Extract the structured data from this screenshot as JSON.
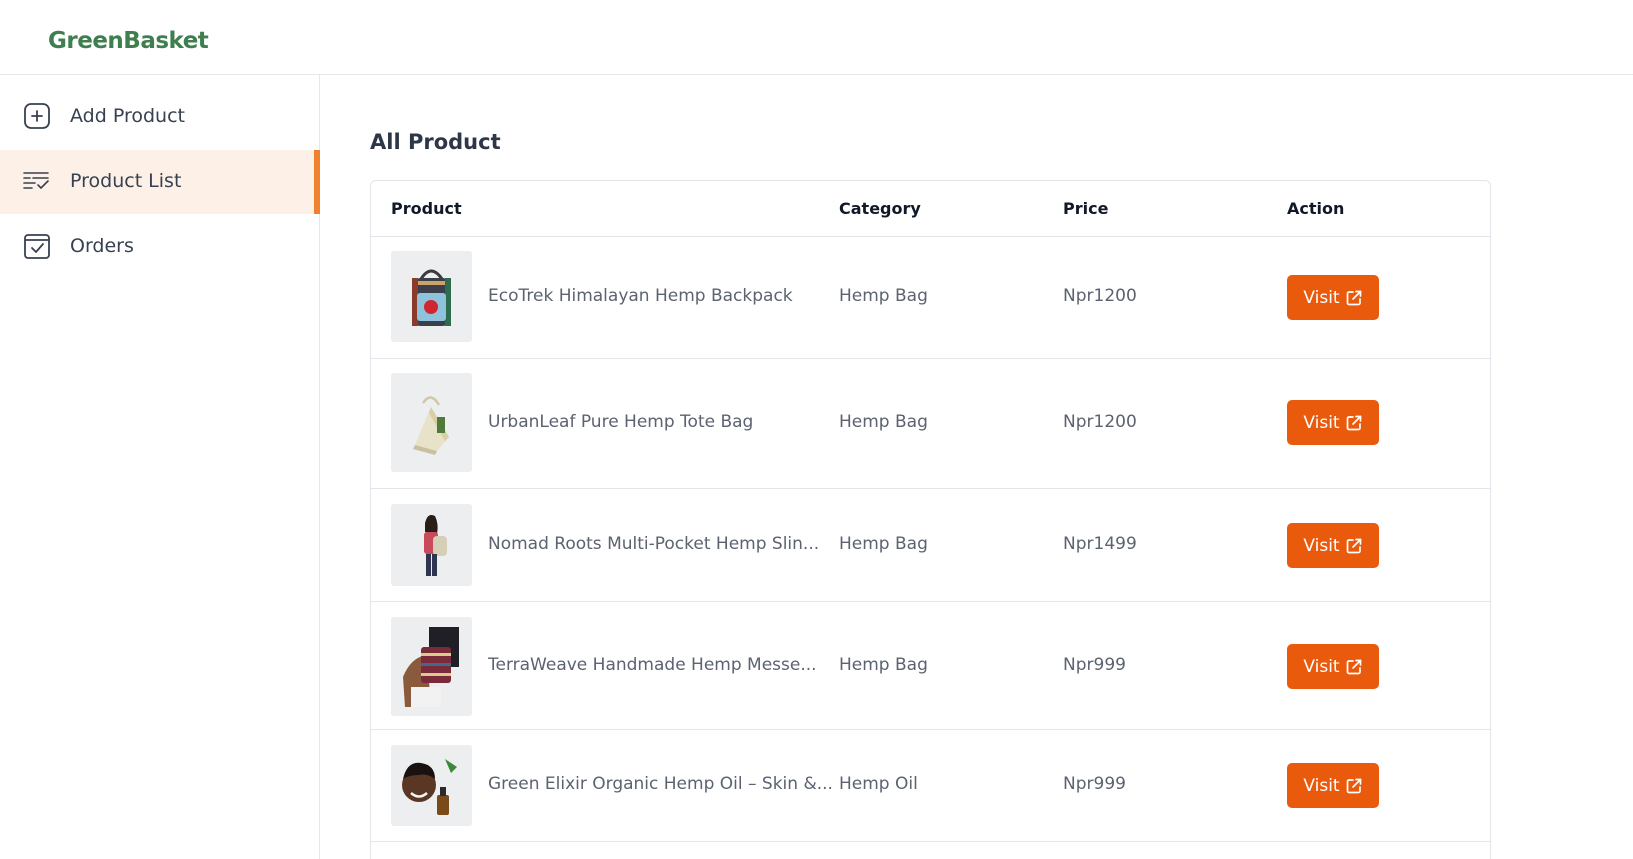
{
  "app": {
    "name": "GreenBasket"
  },
  "sidebar": {
    "items": [
      {
        "label": "Add Product",
        "icon": "add-square-icon",
        "active": false
      },
      {
        "label": "Product List",
        "icon": "list-check-icon",
        "active": true
      },
      {
        "label": "Orders",
        "icon": "calendar-check-icon",
        "active": false
      }
    ]
  },
  "main": {
    "title": "All Product",
    "table": {
      "headers": {
        "product": "Product",
        "category": "Category",
        "price": "Price",
        "action": "Action"
      },
      "rows": [
        {
          "name": "EcoTrek Himalayan Hemp Backpack",
          "category": "Hemp Bag",
          "price": "Npr1200",
          "action": "Visit",
          "image": "backpack-image"
        },
        {
          "name": "UrbanLeaf Pure Hemp Tote Bag",
          "category": "Hemp Bag",
          "price": "Npr1200",
          "action": "Visit",
          "image": "tote-bag-image"
        },
        {
          "name": "Nomad Roots Multi-Pocket Hemp Slin...",
          "category": "Hemp Bag",
          "price": "Npr1499",
          "action": "Visit",
          "image": "sling-bag-image"
        },
        {
          "name": "TerraWeave Handmade Hemp Messe...",
          "category": "Hemp Bag",
          "price": "Npr999",
          "action": "Visit",
          "image": "messenger-bag-image"
        },
        {
          "name": "Green Elixir Organic Hemp Oil – Skin &...",
          "category": "Hemp Oil",
          "price": "Npr999",
          "action": "Visit",
          "image": "hemp-oil-image"
        }
      ]
    }
  },
  "colors": {
    "brand": "#3f7f4f",
    "accent": "#ea5a0c",
    "active_bg": "#fdf0e7",
    "active_bar": "#f0812d"
  }
}
